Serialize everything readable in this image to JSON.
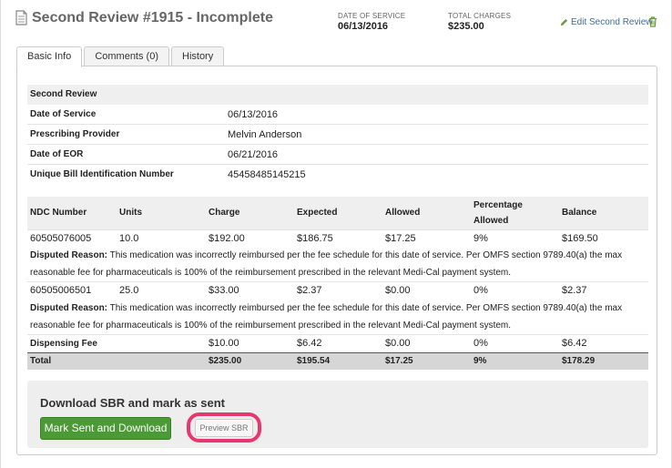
{
  "header": {
    "title": "Second Review #1915 - Incomplete",
    "date_of_service_label": "DATE OF SERVICE",
    "date_of_service": "06/13/2016",
    "total_charges_label": "TOTAL CHARGES",
    "total_charges": "$235.00",
    "edit_label": "Edit Second Review"
  },
  "tabs": [
    {
      "label": "Basic Info",
      "active": true
    },
    {
      "label": "Comments (0)",
      "active": false
    },
    {
      "label": "History",
      "active": false
    }
  ],
  "info": {
    "section_title": "Second Review",
    "rows": [
      {
        "label": "Date of Service",
        "value": "06/13/2016"
      },
      {
        "label": "Prescribing Provider",
        "value": "Melvin Anderson"
      },
      {
        "label": "Date of EOR",
        "value": "06/21/2016"
      },
      {
        "label": "Unique Bill Identification Number",
        "value": "45458485145215"
      }
    ]
  },
  "lines": {
    "columns": [
      "NDC Number",
      "Units",
      "Charge",
      "Expected",
      "Allowed",
      "Percentage Allowed",
      "Balance"
    ],
    "items": [
      {
        "ndc": "60505076005",
        "units": "10.0",
        "charge": "$192.00",
        "expected": "$186.75",
        "allowed": "$17.25",
        "percentage": "9%",
        "balance": "$169.50",
        "reason_label": "Disputed Reason:",
        "reason": " This medication was incorrectly reimbursed per the fee schedule for this date of service. Per OMFS section 9789.40(a) the max reasonable fee for pharmaceuticals is 100% of the reimbursement prescribed in the relevant Medi-Cal payment system."
      },
      {
        "ndc": "60505006501",
        "units": "25.0",
        "charge": "$33.00",
        "expected": "$2.37",
        "allowed": "$0.00",
        "percentage": "0%",
        "balance": "$2.37",
        "reason_label": "Disputed Reason:",
        "reason": " This medication was incorrectly reimbursed per the fee schedule for this date of service. Per OMFS section 9789.40(a) the max reasonable fee for pharmaceuticals is 100% of the reimbursement prescribed in the relevant Medi-Cal payment system."
      }
    ],
    "dispensing_fee": {
      "label": "Dispensing Fee",
      "charge": "$10.00",
      "expected": "$6.42",
      "allowed": "$0.00",
      "percentage": "0%",
      "balance": "$6.42"
    },
    "total": {
      "label": "Total",
      "charge": "$235.00",
      "expected": "$195.54",
      "allowed": "$17.25",
      "percentage": "9%",
      "balance": "$178.29"
    }
  },
  "sbr": {
    "title": "Download SBR and mark as sent",
    "primary_button": "Mark Sent and Download",
    "preview_button": "Preview SBR"
  },
  "colors": {
    "accent_green": "#4a9a35",
    "highlight_pink": "#e8366f",
    "link_blue": "#3e6e98"
  }
}
